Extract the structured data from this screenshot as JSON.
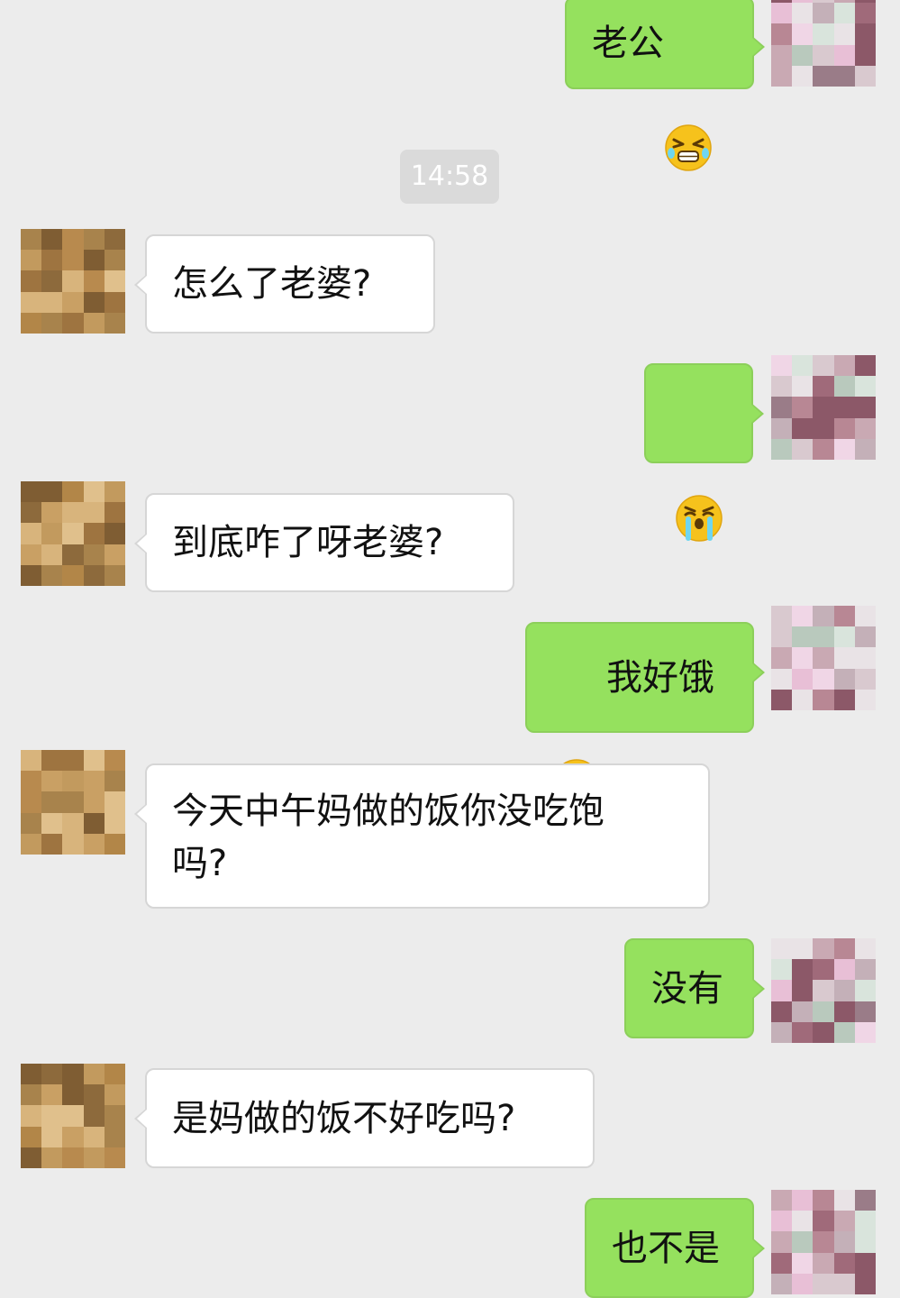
{
  "timestamp": "14:58",
  "colors": {
    "background": "#ececec",
    "sent_bubble": "#95e15e",
    "received_bubble": "#ffffff",
    "timestamp_bg": "#dadada"
  },
  "messages": [
    {
      "side": "sent",
      "text": "老公",
      "emoji_after": "grimacing-tears-emoji"
    },
    {
      "side": "received",
      "text": "怎么了老婆?"
    },
    {
      "side": "sent",
      "text": "",
      "emoji_only": "crying-loudly-emoji"
    },
    {
      "side": "received",
      "text": "到底咋了呀老婆?"
    },
    {
      "side": "sent",
      "text": "我好饿",
      "emoji_before": "drooling-emoji"
    },
    {
      "side": "received",
      "text": "今天中午妈做的饭你没吃饱\n吗?"
    },
    {
      "side": "sent",
      "text": "没有"
    },
    {
      "side": "received",
      "text": "是妈做的饭不好吃吗?"
    },
    {
      "side": "sent",
      "text": "也不是"
    }
  ]
}
